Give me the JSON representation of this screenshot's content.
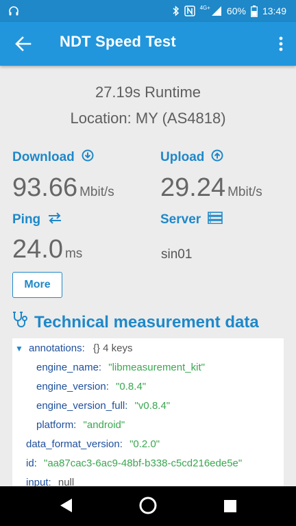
{
  "status_bar": {
    "network": "4G+",
    "battery": "60%",
    "time": "13:49"
  },
  "app_bar": {
    "title": "NDT Speed Test"
  },
  "summary": {
    "runtime": "27.19s Runtime",
    "location": "Location: MY (AS4818)"
  },
  "metrics": {
    "download": {
      "label": "Download",
      "value": "93.66",
      "unit": "Mbit/s"
    },
    "upload": {
      "label": "Upload",
      "value": "29.24",
      "unit": "Mbit/s"
    },
    "ping": {
      "label": "Ping",
      "value": "24.0",
      "unit": "ms"
    },
    "server": {
      "label": "Server",
      "value": "sin01"
    }
  },
  "more_button": "More",
  "technical": {
    "heading": "Technical measurement data",
    "rows": [
      {
        "key": "annotations:",
        "meta": "{}  4 keys"
      },
      {
        "key": "engine_name:",
        "value": "\"libmeasurement_kit\""
      },
      {
        "key": "engine_version:",
        "value": "\"0.8.4\""
      },
      {
        "key": "engine_version_full:",
        "value": "\"v0.8.4\""
      },
      {
        "key": "platform:",
        "value": "\"android\""
      },
      {
        "key": "data_format_version:",
        "value": "\"0.2.0\""
      },
      {
        "key": "id:",
        "value": "\"aa87cac3-6ac9-48bf-b338-c5cd216ede5e\""
      },
      {
        "key": "input:",
        "meta": "null"
      }
    ]
  },
  "colors": {
    "primary": "#2196dd",
    "status_bar": "#1e88c9",
    "accent_text": "#1e88c9",
    "json_key": "#1e4f9c",
    "json_string": "#3aa650"
  }
}
